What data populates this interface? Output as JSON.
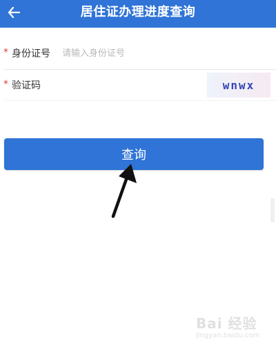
{
  "header": {
    "title": "居住证办理进度查询",
    "back_icon": "arrow-left-icon",
    "background": "#2f74d6"
  },
  "form": {
    "id_field": {
      "required_mark": "*",
      "label": "身份证号",
      "placeholder": "请输入身份证号",
      "value": ""
    },
    "captcha_field": {
      "required_mark": "*",
      "label": "验证码",
      "captcha_text": "wnwx"
    },
    "submit_label": "查询"
  },
  "annotation": {
    "arrow_icon": "pointer-arrow-icon"
  },
  "watermark": {
    "text": "Bai 经验",
    "url": "jingyan.baidu.com"
  }
}
